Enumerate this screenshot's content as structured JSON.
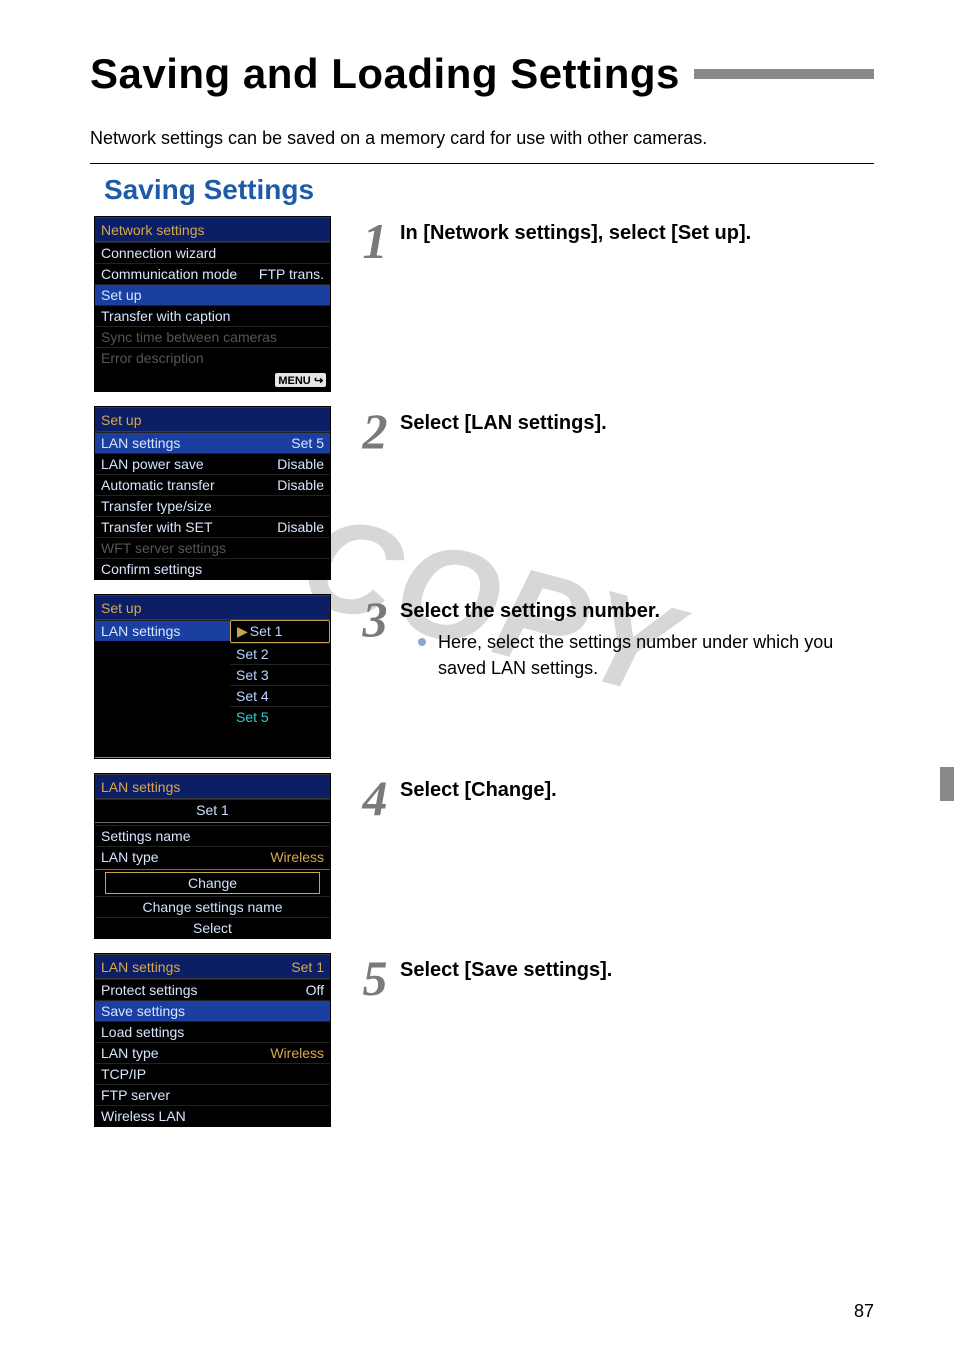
{
  "page_title": "Saving and Loading Settings",
  "intro": "Network settings can be saved on a memory card for use with other cameras.",
  "section_heading": "Saving Settings",
  "watermark": "COPY",
  "page_number": "87",
  "steps": [
    {
      "num": "1",
      "title": "In [Network settings], select [Set up].",
      "bullets": [],
      "cam": {
        "title": "Network settings",
        "rows": [
          {
            "label": "Connection wizard",
            "value": "",
            "style": ""
          },
          {
            "label": "Communication mode",
            "value": "FTP trans.",
            "style": ""
          },
          {
            "label": "Set up",
            "value": "",
            "style": "hl"
          },
          {
            "label": "Transfer with caption",
            "value": "",
            "style": ""
          },
          {
            "label": "Sync time between cameras",
            "value": "",
            "style": "dim"
          },
          {
            "label": "Error description",
            "value": "",
            "style": "dim"
          }
        ],
        "footer_badge": "MENU",
        "footer_icon": "↩"
      }
    },
    {
      "num": "2",
      "title": "Select [LAN settings].",
      "bullets": [],
      "cam": {
        "title": "Set up",
        "rows": [
          {
            "label": "LAN settings",
            "value": "Set 5",
            "style": "hl"
          },
          {
            "label": "LAN power save",
            "value": "Disable",
            "style": ""
          },
          {
            "label": "Automatic transfer",
            "value": "Disable",
            "style": ""
          },
          {
            "label": "Transfer type/size",
            "value": "",
            "style": ""
          },
          {
            "label": "Transfer with SET",
            "value": "Disable",
            "style": ""
          },
          {
            "label": "WFT server settings",
            "value": "",
            "style": "dim"
          },
          {
            "label": "Confirm settings",
            "value": "",
            "style": ""
          }
        ]
      }
    },
    {
      "num": "3",
      "title": "Select the settings number.",
      "bullets": [
        "Here, select the settings number under which you saved LAN settings."
      ],
      "cam": {
        "title": "Set up",
        "left_label": "LAN settings",
        "options": [
          {
            "text": "Set 1",
            "selected": true
          },
          {
            "text": "Set 2"
          },
          {
            "text": "Set 3"
          },
          {
            "text": "Set 4"
          },
          {
            "text": "Set 5",
            "teal": true
          }
        ]
      }
    },
    {
      "num": "4",
      "title": "Select [Change].",
      "bullets": [],
      "cam": {
        "title": "LAN settings",
        "subtitle": "Set 1",
        "rows": [
          {
            "label": "Settings name",
            "value": "",
            "style": ""
          },
          {
            "label": "LAN type",
            "value": "Wireless",
            "style": "",
            "gold": true
          }
        ],
        "buttons": [
          "Change",
          "Change settings name",
          "Select"
        ],
        "framed_index": 0
      }
    },
    {
      "num": "5",
      "title": "Select [Save settings].",
      "bullets": [],
      "cam": {
        "title": "LAN settings",
        "title_value": "Set 1",
        "rows": [
          {
            "label": "Protect settings",
            "value": "Off",
            "style": ""
          },
          {
            "label": "Save settings",
            "value": "",
            "style": "hl"
          },
          {
            "label": "Load settings",
            "value": "",
            "style": ""
          },
          {
            "label": "LAN type",
            "value": "Wireless",
            "style": "",
            "gold": true
          },
          {
            "label": "TCP/IP",
            "value": "",
            "style": ""
          },
          {
            "label": "FTP server",
            "value": "",
            "style": ""
          },
          {
            "label": "Wireless LAN",
            "value": "",
            "style": ""
          }
        ]
      }
    }
  ]
}
